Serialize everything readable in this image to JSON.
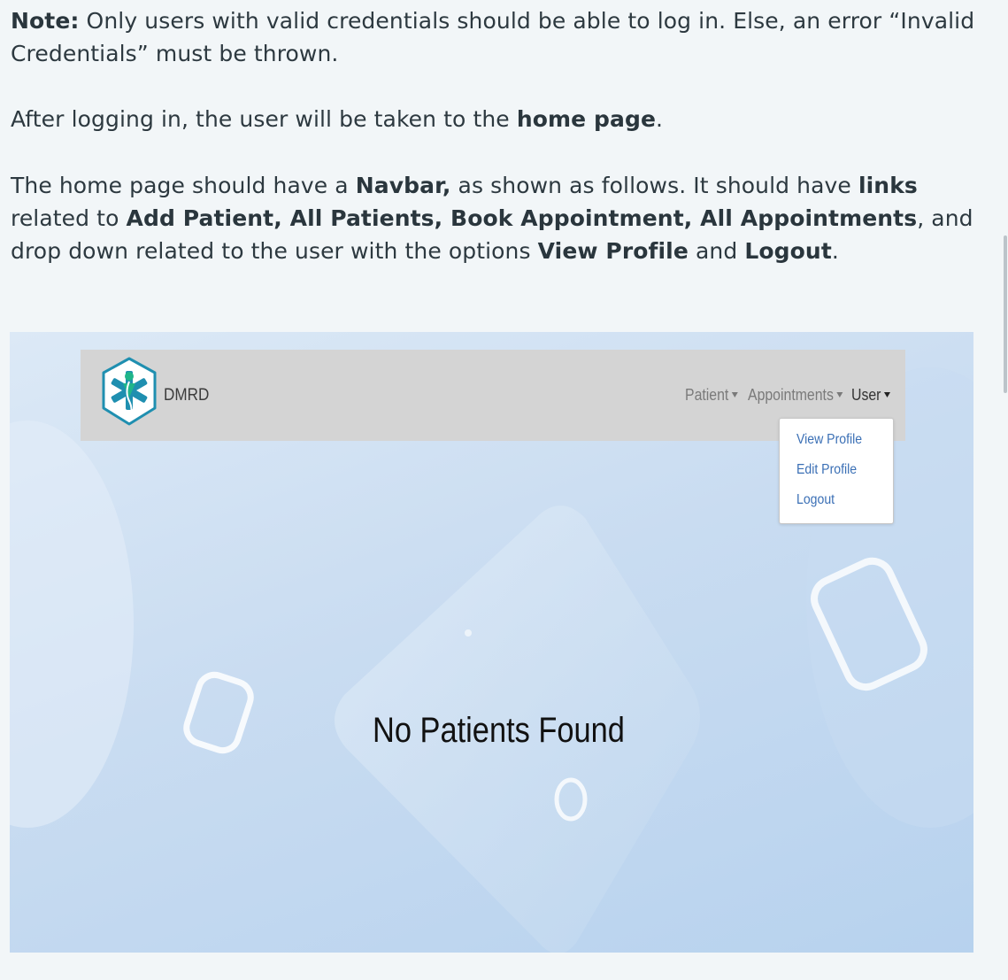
{
  "doc": {
    "p1": {
      "note_label": "Note:",
      "text": " Only users with valid credentials should be able to log in. Else, an error “Invalid Credentials” must be thrown."
    },
    "p2": {
      "pre": "After logging in, the user will be taken to the ",
      "bold": "home page",
      "post": "."
    },
    "p3": {
      "t1": "The home page should have a ",
      "b1": "Navbar,",
      "t2": " as shown as follows. It should have ",
      "b2": "links",
      "t3": " related to ",
      "b3": "Add Patient, All Patients, Book Appointment, All Appointments",
      "t4": ", and drop down related to the user with the options ",
      "b4": "View Profile",
      "t5": " and ",
      "b5": "Logout",
      "t6": "."
    }
  },
  "app": {
    "brand": "DMRD",
    "nav": {
      "patient": "Patient",
      "appointments": "Appointments",
      "user": "User"
    },
    "user_menu": [
      "View Profile",
      "Edit Profile",
      "Logout"
    ],
    "empty_message": "No Patients Found"
  },
  "colors": {
    "navbar_bg": "#d4d4d4",
    "dropdown_link": "#3a6fb5",
    "logo_teal": "#1f8fb0",
    "logo_green": "#20b58a"
  },
  "icons": {
    "logo": "medical-star-of-life-icon",
    "dropdown_caret": "caret-down-icon"
  }
}
